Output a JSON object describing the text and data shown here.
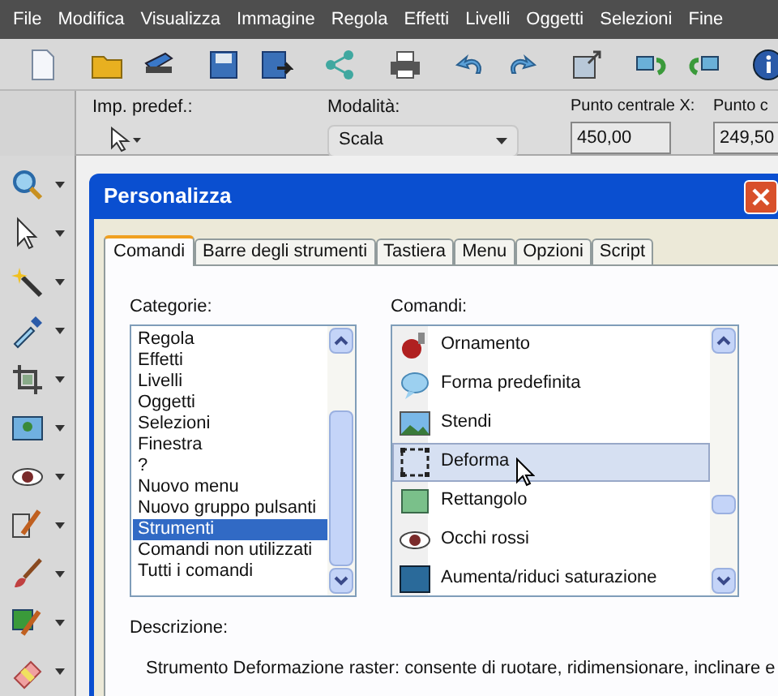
{
  "menu": [
    "File",
    "Modifica",
    "Visualizza",
    "Immagine",
    "Regola",
    "Effetti",
    "Livelli",
    "Oggetti",
    "Selezioni",
    "Fine"
  ],
  "options_bar": {
    "preset_label": "Imp. predef.:",
    "mode_label": "Modalità:",
    "mode_value": "Scala",
    "center_x_label": "Punto centrale X:",
    "center_x_value": "450,00",
    "center_y_label": "Punto c",
    "center_y_value": "249,50"
  },
  "dialog": {
    "title": "Personalizza",
    "tabs": [
      {
        "label": "Comandi",
        "selected": true
      },
      {
        "label": "Barre degli strumenti",
        "selected": false
      },
      {
        "label": "Tastiera",
        "selected": false
      },
      {
        "label": "Menu",
        "selected": false
      },
      {
        "label": "Opzioni",
        "selected": false
      },
      {
        "label": "Script",
        "selected": false
      }
    ],
    "categories": {
      "label": "Categorie:",
      "items": [
        {
          "label": "Regola",
          "selected": false
        },
        {
          "label": "Effetti",
          "selected": false
        },
        {
          "label": "Livelli",
          "selected": false
        },
        {
          "label": "Oggetti",
          "selected": false
        },
        {
          "label": "Selezioni",
          "selected": false
        },
        {
          "label": "Finestra",
          "selected": false
        },
        {
          "label": "?",
          "selected": false
        },
        {
          "label": "Nuovo menu",
          "selected": false
        },
        {
          "label": "Nuovo gruppo pulsanti",
          "selected": false
        },
        {
          "label": "Strumenti",
          "selected": true
        },
        {
          "label": "Comandi non utilizzati",
          "selected": false
        },
        {
          "label": "Tutti i comandi",
          "selected": false
        }
      ]
    },
    "commands": {
      "label": "Comandi:",
      "items": [
        {
          "label": "Ornamento",
          "selected": false
        },
        {
          "label": "Forma predefinita",
          "selected": false
        },
        {
          "label": "Stendi",
          "selected": false
        },
        {
          "label": "Deforma",
          "selected": true
        },
        {
          "label": "Rettangolo",
          "selected": false
        },
        {
          "label": "Occhi rossi",
          "selected": false
        },
        {
          "label": "Aumenta/riduci saturazione",
          "selected": false
        }
      ]
    },
    "description": {
      "label": "Descrizione:",
      "text": "Strumento Deformazione raster: consente di ruotare, ridimensionare, inclinare e"
    }
  }
}
